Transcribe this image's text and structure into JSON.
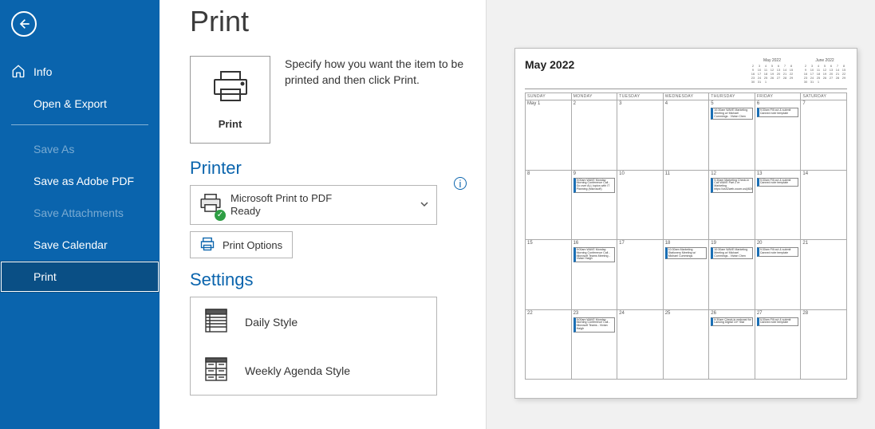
{
  "sidebar": {
    "items": [
      {
        "label": "Info",
        "icon": "home-icon"
      },
      {
        "label": "Open & Export"
      },
      {
        "label": "Save As",
        "dim": true
      },
      {
        "label": "Save as Adobe PDF"
      },
      {
        "label": "Save Attachments",
        "dim": true
      },
      {
        "label": "Save Calendar"
      },
      {
        "label": "Print",
        "active": true
      }
    ]
  },
  "page": {
    "title": "Print",
    "print_button_label": "Print",
    "description": "Specify how you want the item to be printed and then click Print."
  },
  "printer": {
    "section_title": "Printer",
    "name": "Microsoft Print to PDF",
    "status": "Ready",
    "options_button": "Print Options"
  },
  "settings": {
    "section_title": "Settings",
    "styles": [
      {
        "label": "Daily Style",
        "icon": "daily-style-icon"
      },
      {
        "label": "Weekly Agenda Style",
        "icon": "weekly-agenda-icon"
      }
    ]
  },
  "preview": {
    "month_title": "May 2022",
    "mini_months": [
      "May 2022",
      "June 2022"
    ],
    "weekdays": [
      "SUNDAY",
      "MONDAY",
      "TUESDAY",
      "WEDNESDAY",
      "THURSDAY",
      "FRIDAY",
      "SATURDAY"
    ],
    "weeks": [
      [
        {
          "d": "May 1"
        },
        {
          "d": "2"
        },
        {
          "d": "3"
        },
        {
          "d": "4"
        },
        {
          "d": "5",
          "events": [
            "10:30am WAVE Marketing Meeting w/ Michael Cummings - Vivian Chen"
          ]
        },
        {
          "d": "6",
          "events": [
            "9:30am Fill out & submit Canned note template"
          ]
        },
        {
          "d": "7"
        }
      ],
      [
        {
          "d": "8"
        },
        {
          "d": "9",
          "events": [
            "9:00am WAVE Monday Morning Conference Call - Go over ALL topics with IT Planning (Microsoft)"
          ]
        },
        {
          "d": "10"
        },
        {
          "d": "11"
        },
        {
          "d": "12",
          "events": [
            "9:30am Marketing Check-in Call WAVE Part 2 re Marketing https://us02web.zoom.us/j/8263155202..."
          ]
        },
        {
          "d": "13",
          "events": [
            "9:30am Fill out & submit Canned note template"
          ]
        },
        {
          "d": "14"
        }
      ],
      [
        {
          "d": "15"
        },
        {
          "d": "16",
          "events": [
            "9:00am WAVE Monday Morning Conference Call - Microsoft Teams Meeting - Vivian Haigh"
          ]
        },
        {
          "d": "17"
        },
        {
          "d": "18",
          "events": [
            "10:30am Marketing Stationery Meeting w/ Michael Cummings"
          ]
        },
        {
          "d": "19",
          "events": [
            "10:30am WAVE Marketing Meeting w/ Michael Cummings - Vivian Chen"
          ]
        },
        {
          "d": "20",
          "events": [
            "9:30am Fill out & submit Canned note template"
          ]
        },
        {
          "d": "21"
        }
      ],
      [
        {
          "d": "22"
        },
        {
          "d": "23",
          "events": [
            "9:00am WAVE Monday Morning Conference Call - Microsoft Teams - Vivian Haigh"
          ]
        },
        {
          "d": "24"
        },
        {
          "d": "25"
        },
        {
          "d": "26",
          "events": [
            "9:30am Check-in webcast for Lansing Digital 10+ Star"
          ]
        },
        {
          "d": "27",
          "events": [
            "9:30am Fill out & submit Canned note template"
          ]
        },
        {
          "d": "28"
        }
      ]
    ]
  }
}
